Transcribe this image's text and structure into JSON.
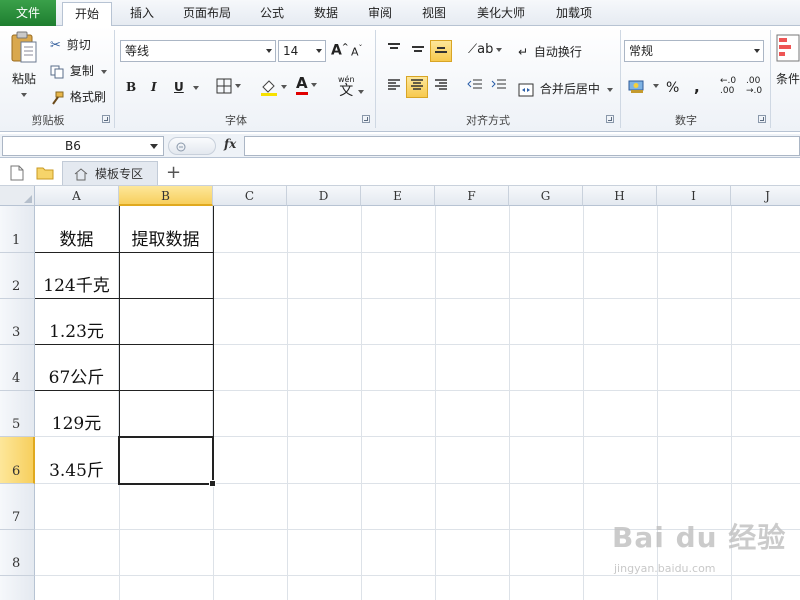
{
  "menu": {
    "file": "文件",
    "tabs": [
      "开始",
      "插入",
      "页面布局",
      "公式",
      "数据",
      "审阅",
      "视图",
      "美化大师",
      "加载项"
    ],
    "active_index": 0
  },
  "clipboard": {
    "paste": "粘贴",
    "cut": "剪切",
    "copy": "复制",
    "format_painter": "格式刷",
    "group_label": "剪贴板"
  },
  "font": {
    "name": "等线",
    "size": "14",
    "bold": "B",
    "italic": "I",
    "underline": "U",
    "grow": "A",
    "shrink": "A",
    "font_color": "A",
    "phonetic": "wén",
    "group_label": "字体"
  },
  "alignment": {
    "wrap_text": "自动换行",
    "merge_center": "合并后居中",
    "group_label": "对齐方式"
  },
  "number": {
    "format": "常规",
    "percent": "%",
    "comma": ",",
    "inc_decimal": "←.0\n.00",
    "dec_decimal": ".00\n→.0",
    "group_label": "数字"
  },
  "styles": {
    "conditional": "条件"
  },
  "formula_bar": {
    "name_box": "B6",
    "fx": "fx",
    "value": ""
  },
  "doc_tabs": {
    "template_tab": "模板专区",
    "add": "+"
  },
  "grid": {
    "columns": [
      "A",
      "B",
      "C",
      "D",
      "E",
      "F",
      "G",
      "H",
      "I",
      "J"
    ],
    "rows": [
      "1",
      "2",
      "3",
      "4",
      "5",
      "6",
      "7",
      "8"
    ],
    "selected_cell": "B6",
    "cells": {
      "A1": "数据",
      "B1": "提取数据",
      "A2": "124千克",
      "A3": "1.23元",
      "A4": "67公斤",
      "A5": "129元",
      "A6": "3.45斤"
    }
  },
  "watermark": {
    "main": "Bai du 经验",
    "sub": "jingyan.baidu.com"
  }
}
